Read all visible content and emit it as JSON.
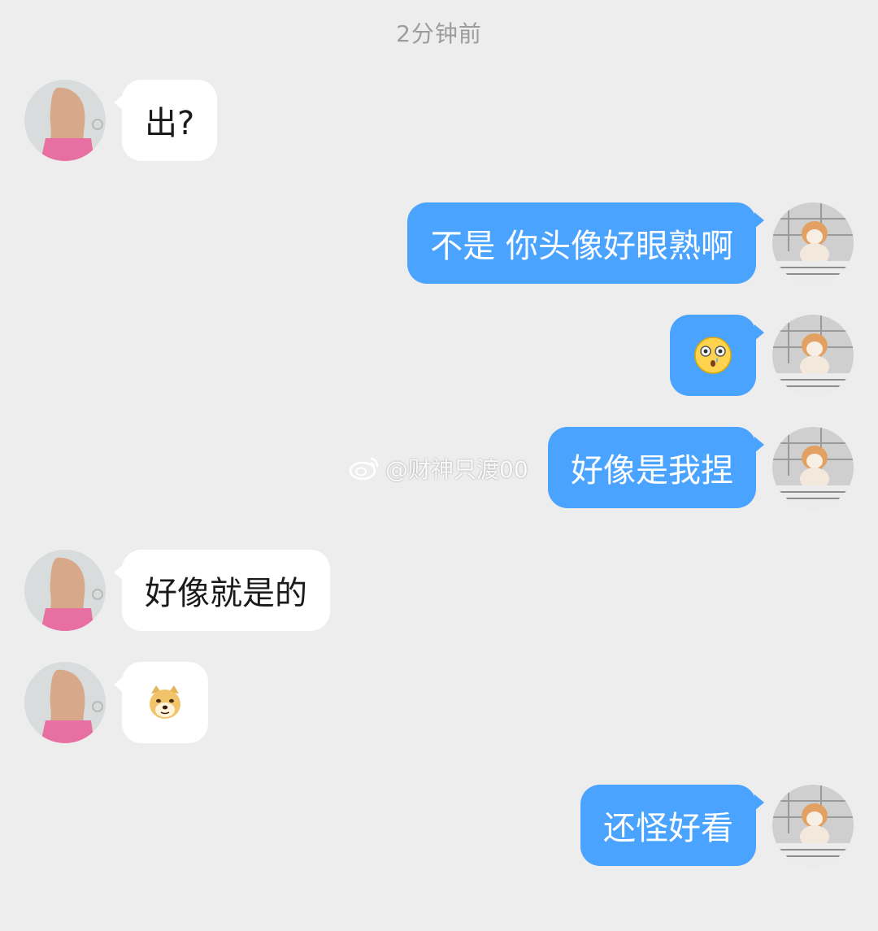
{
  "timestamp": "2分钟前",
  "messages": [
    {
      "side": "left",
      "text": "出?"
    },
    {
      "side": "right",
      "text": "不是 你头像好眼熟啊"
    },
    {
      "side": "right",
      "emoji": "flushed-face-emoji"
    },
    {
      "side": "right",
      "text": "好像是我捏"
    },
    {
      "side": "left",
      "text": "好像就是的"
    },
    {
      "side": "left",
      "emoji": "doge-emoji"
    },
    {
      "side": "right",
      "text": "还怪好看"
    }
  ],
  "watermark": {
    "text": "@财神只渡00",
    "icon": "weibo-logo-icon"
  },
  "colors": {
    "background": "#ededed",
    "outgoing_bubble": "#4aa3ff",
    "incoming_bubble": "#ffffff",
    "timestamp_text": "#9c9c9c"
  }
}
